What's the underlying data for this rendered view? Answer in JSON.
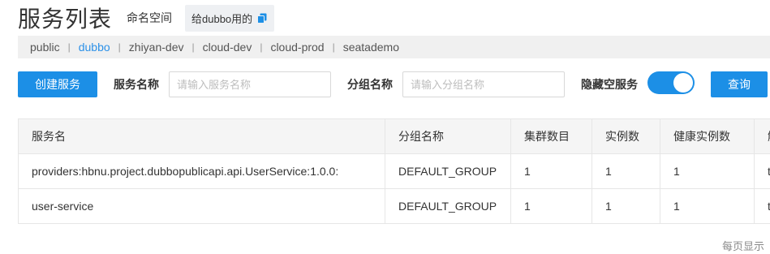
{
  "header": {
    "title": "服务列表",
    "namespace_label": "命名空间",
    "namespace_value": "给dubbo用的"
  },
  "namespaces": {
    "items": [
      "public",
      "dubbo",
      "zhiyan-dev",
      "cloud-dev",
      "cloud-prod",
      "seatademo"
    ],
    "active": "dubbo",
    "separator": "|"
  },
  "toolbar": {
    "create_label": "创建服务",
    "service_name_label": "服务名称",
    "service_name_placeholder": "请输入服务名称",
    "group_name_label": "分组名称",
    "group_name_placeholder": "请输入分组名称",
    "hide_empty_label": "隐藏空服务",
    "hide_empty_on": true,
    "query_label": "查询"
  },
  "table": {
    "columns": [
      "服务名",
      "分组名称",
      "集群数目",
      "实例数",
      "健康实例数",
      "触"
    ],
    "rows": [
      [
        "providers:hbnu.project.dubbopublicapi.api.UserService:1.0.0:",
        "DEFAULT_GROUP",
        "1",
        "1",
        "1",
        "t"
      ],
      [
        "user-service",
        "DEFAULT_GROUP",
        "1",
        "1",
        "1",
        "t"
      ]
    ]
  },
  "pager": {
    "text": "每页显示"
  },
  "colors": {
    "primary": "#1c8fe6",
    "active_link": "#2c91e8"
  }
}
